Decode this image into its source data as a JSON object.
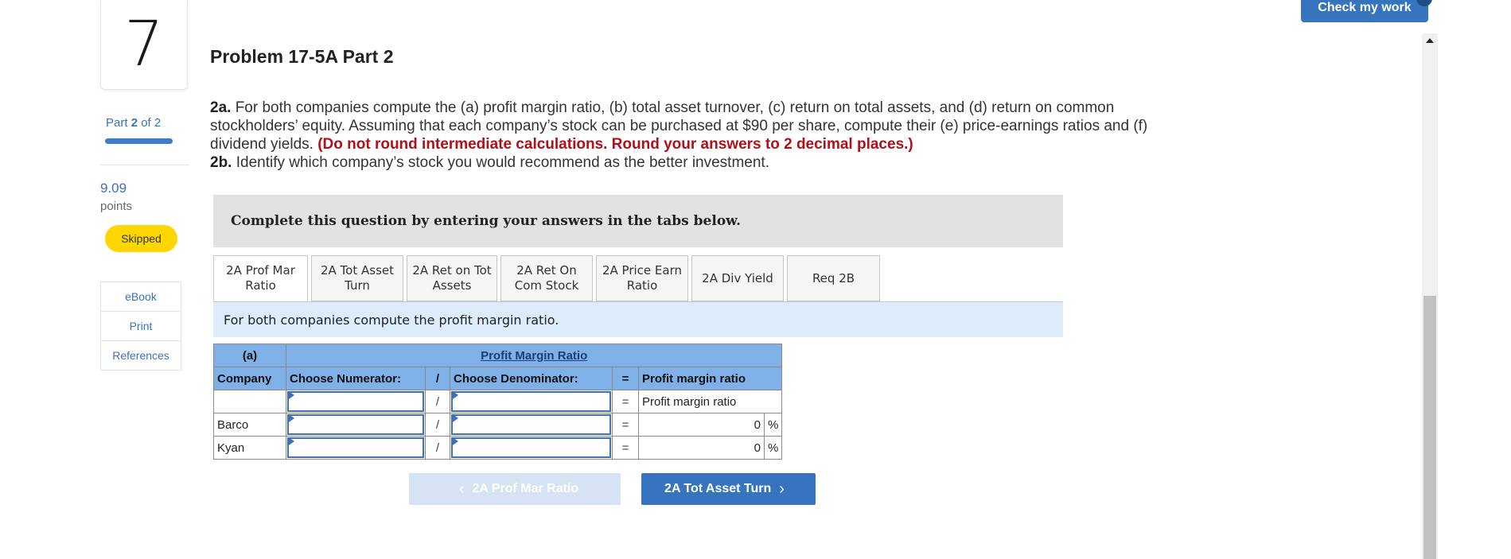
{
  "header": {
    "question_number": "7",
    "title": "Problem 17-5A Part 2",
    "check_button": "Check my work"
  },
  "rail": {
    "part_prefix": "Part",
    "part_current": "2",
    "part_suffix": "of 2",
    "points_value": "9.09",
    "points_label": "points",
    "status": "Skipped",
    "links": [
      "eBook",
      "Print",
      "References"
    ]
  },
  "instructions": {
    "p2a_label": "2a.",
    "p2a_text": " For both companies compute the (a) profit margin ratio, (b) total asset turnover, (c) return on total assets, and (d) return on common stockholders’ equity. Assuming that each company’s stock can be purchased at $90 per share, compute their (e) price-earnings ratios and (f) dividend yields. ",
    "p2a_red": "(Do not round intermediate calculations. Round your answers to 2 decimal places.)",
    "p2b_label": "2b.",
    "p2b_text": " Identify which company’s stock you would recommend as the better investment."
  },
  "banner": "Complete this question by entering your answers in the tabs below.",
  "tabs": [
    {
      "line1": "2A Prof Mar",
      "line2": "Ratio"
    },
    {
      "line1": "2A Tot Asset",
      "line2": "Turn"
    },
    {
      "line1": "2A Ret on Tot",
      "line2": "Assets"
    },
    {
      "line1": "2A Ret On",
      "line2": "Com Stock"
    },
    {
      "line1": "2A Price Earn",
      "line2": "Ratio"
    },
    {
      "line1": "2A Div Yield",
      "line2": ""
    },
    {
      "line1": "Req 2B",
      "line2": ""
    }
  ],
  "tab_description": "For both companies compute the profit margin ratio.",
  "table": {
    "part_label": "(a)",
    "section_title": "Profit Margin Ratio",
    "col_company": "Company",
    "col_numerator": "Choose Numerator:",
    "divide_sign": "/",
    "col_denominator": "Choose Denominator:",
    "equals_sign": "=",
    "col_result": "Profit margin ratio",
    "formula_result": "Profit margin ratio",
    "rows": [
      {
        "company": "Barco",
        "value": "0",
        "unit": "%"
      },
      {
        "company": "Kyan",
        "value": "0",
        "unit": "%"
      }
    ]
  },
  "nav": {
    "prev_label": "2A Prof Mar Ratio",
    "next_label": "2A Tot Asset Turn",
    "prev_chevron": "‹",
    "next_chevron": "›"
  }
}
